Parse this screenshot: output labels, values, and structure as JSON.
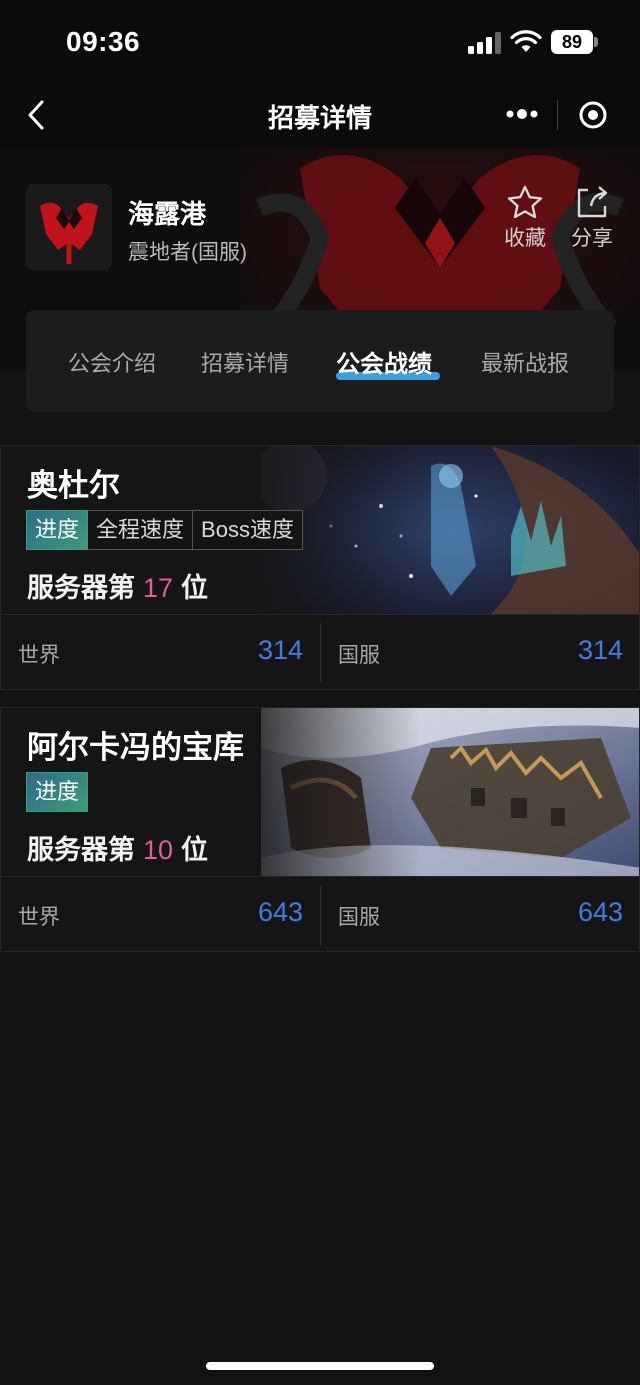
{
  "status_bar": {
    "time": "09:36",
    "battery": "89"
  },
  "nav": {
    "title": "招募详情"
  },
  "guild": {
    "name": "海露港",
    "server": "震地者(国服)",
    "favorite_label": "收藏",
    "share_label": "分享"
  },
  "tabs": [
    {
      "label": "公会介绍",
      "active": false
    },
    {
      "label": "招募详情",
      "active": false
    },
    {
      "label": "公会战绩",
      "active": true
    },
    {
      "label": "最新战报",
      "active": false
    }
  ],
  "raids": [
    {
      "name": "奥杜尔",
      "tags": [
        "进度",
        "全程速度",
        "Boss速度"
      ],
      "rank_prefix": "服务器第",
      "rank": "17",
      "rank_suffix": "位",
      "world_label": "世界",
      "world_value": "314",
      "cn_label": "国服",
      "cn_value": "314"
    },
    {
      "name": "阿尔卡冯的宝库",
      "tags": [
        "进度"
      ],
      "rank_prefix": "服务器第",
      "rank": "10",
      "rank_suffix": "位",
      "world_label": "世界",
      "world_value": "643",
      "cn_label": "国服",
      "cn_value": "643"
    }
  ],
  "colors": {
    "background": "#121212",
    "accent_tab": "#3aa0e0",
    "rank_highlight": "#e05ea0",
    "stat_value": "#3f7fe0",
    "horde_red": "#c0141a"
  }
}
